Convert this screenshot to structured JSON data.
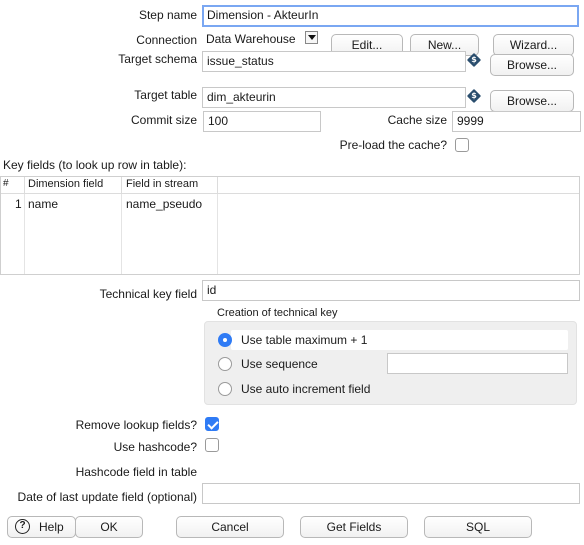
{
  "form": {
    "step_name_label": "Step name",
    "step_name_value": "Dimension - AkteurIn",
    "connection_label": "Connection",
    "connection_value": "Data Warehouse",
    "edit_button": "Edit...",
    "new_button": "New...",
    "wizard_button": "Wizard...",
    "target_schema_label": "Target schema",
    "target_schema_value": "issue_status",
    "browse_schema_button": "Browse...",
    "target_table_label": "Target table",
    "target_table_value": "dim_akteurin",
    "browse_table_button": "Browse...",
    "commit_size_label": "Commit size",
    "commit_size_value": "100",
    "cache_size_label": "Cache size",
    "cache_size_value": "9999",
    "preload_label": "Pre-load the cache?",
    "preload_checked": false
  },
  "key_fields": {
    "title": "Key fields (to look up row in table):",
    "columns": [
      "#",
      "Dimension field",
      "Field in stream"
    ],
    "rows": [
      {
        "num": "1",
        "dimension_field": "name",
        "field_in_stream": "name_pseudo"
      }
    ]
  },
  "technical_key": {
    "label": "Technical key field",
    "value": "id",
    "group_title": "Creation of technical key",
    "options": [
      {
        "label": "Use table maximum + 1",
        "selected": true
      },
      {
        "label": "Use sequence",
        "selected": false
      },
      {
        "label": "Use auto increment field",
        "selected": false
      }
    ],
    "sequence_value": ""
  },
  "options": {
    "remove_lookup_label": "Remove lookup fields?",
    "remove_lookup_checked": true,
    "use_hashcode_label": "Use hashcode?",
    "use_hashcode_checked": false,
    "hashcode_field_label": "Hashcode field in table",
    "date_last_update_label": "Date of last update field (optional)",
    "date_last_update_value": ""
  },
  "footer": {
    "help": "Help",
    "ok": "OK",
    "cancel": "Cancel",
    "get_fields": "Get Fields",
    "sql": "SQL"
  },
  "colors": {
    "accent": "#2f7bf5",
    "focus_border": "#7aa7f2"
  }
}
